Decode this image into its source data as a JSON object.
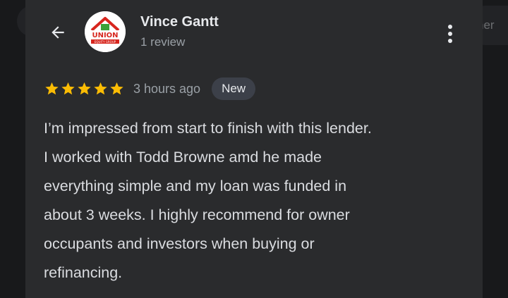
{
  "background": {
    "right_peek_text": "ner"
  },
  "header": {
    "back_icon": "arrow-left-icon",
    "avatar_logo_text": "UNION",
    "avatar_logo_subtext": "EQUITY GROUP",
    "reviewer_name": "Vince Gantt",
    "review_count": "1 review",
    "more_icon": "more-vertical-icon"
  },
  "review": {
    "rating": 5,
    "max_rating": 5,
    "time_ago": "3 hours ago",
    "badge": "New",
    "text_lines": [
      "I’m impressed from start to finish with this lender.",
      "I worked with Todd Browne amd he made",
      "everything simple and my loan was funded in",
      "about 3 weeks. I highly recommend for owner",
      "occupants and investors when buying or",
      "refinancing."
    ]
  },
  "colors": {
    "page_bg": "#18191b",
    "card_bg": "#2a2b2d",
    "star": "#fbbc04",
    "badge_bg": "#3c4049",
    "primary_text": "#e8eaed",
    "secondary_text": "#9aa0a6",
    "logo_red": "#d7261e",
    "logo_green": "#3aa23a"
  }
}
